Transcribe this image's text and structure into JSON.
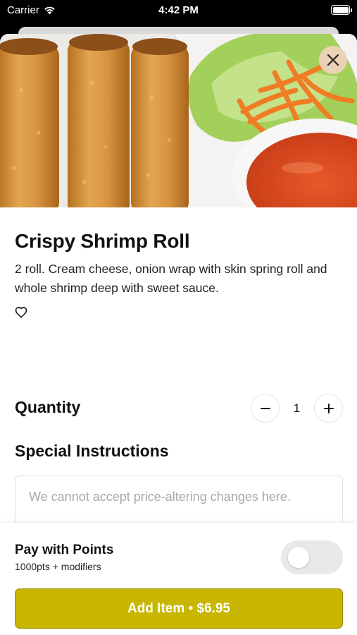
{
  "status_bar": {
    "carrier": "Carrier",
    "time": "4:42 PM"
  },
  "item": {
    "image_icon": "spring-rolls-photo",
    "title": "Crispy Shrimp Roll",
    "description": "2 roll. Cream cheese, onion wrap with skin spring roll and whole shrimp deep with sweet sauce.",
    "favorite_icon": "heart-outline-icon"
  },
  "quantity": {
    "label": "Quantity",
    "value": "1",
    "minus_symbol": "−",
    "plus_symbol": "+"
  },
  "special_instructions": {
    "label": "Special Instructions",
    "placeholder": "We cannot accept price-altering changes here.",
    "value": ""
  },
  "points": {
    "title": "Pay with Points",
    "subtitle": "1000pts + modifiers",
    "enabled": false
  },
  "add_button": {
    "label": "Add Item • $6.95"
  },
  "colors": {
    "accent": "#c8b600",
    "close_bg": "#f0d2be",
    "toggle_off": "#e9e9eb"
  }
}
